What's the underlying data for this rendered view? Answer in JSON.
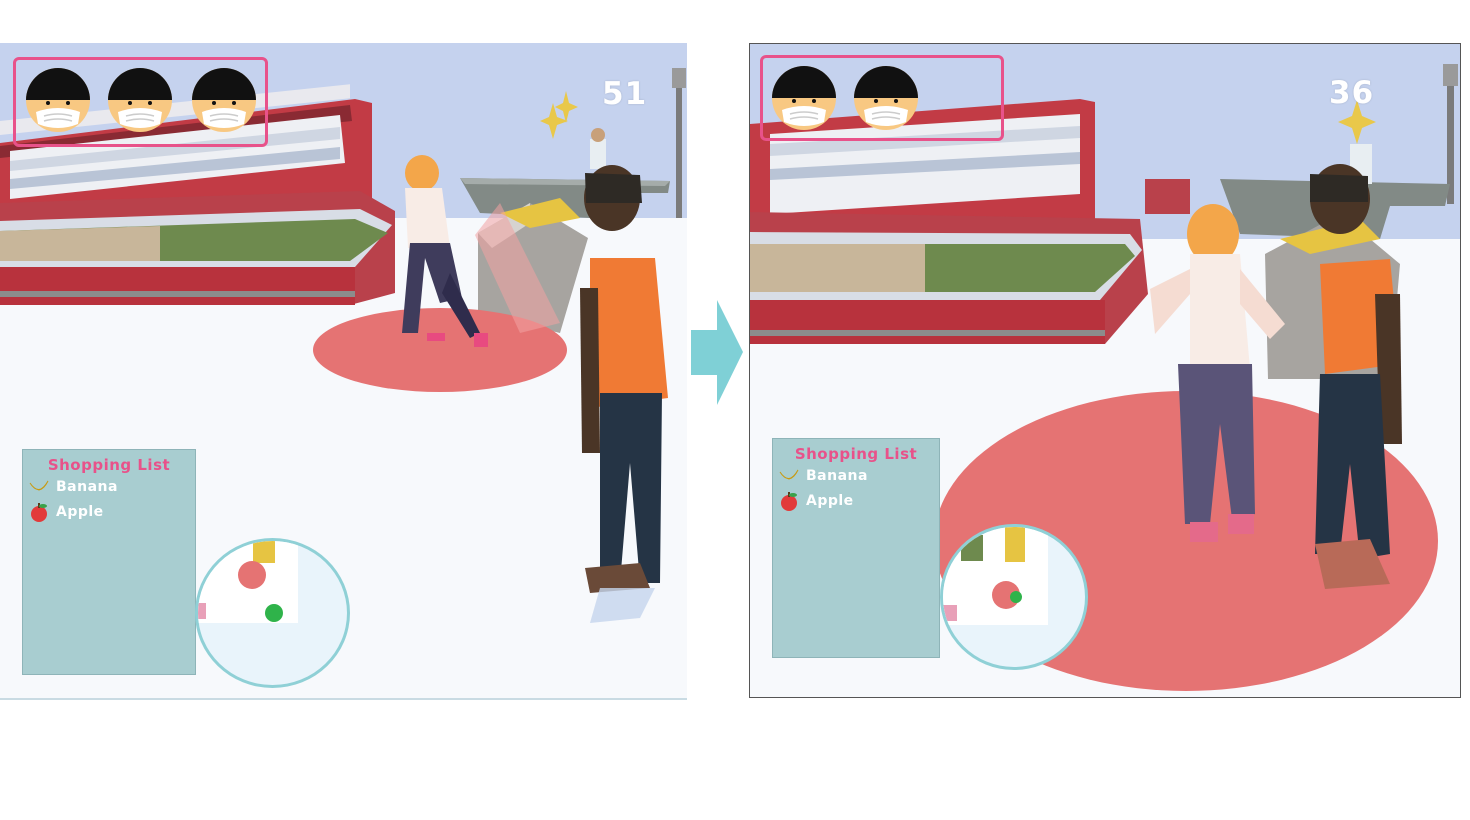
{
  "frames": [
    {
      "id": "before",
      "mask_faces": 3,
      "timer": "51",
      "shopping_list": {
        "title": "Shopping List",
        "items": [
          {
            "label": "Banana",
            "icon": "banana-icon"
          },
          {
            "label": "Apple",
            "icon": "apple-icon"
          }
        ]
      }
    },
    {
      "id": "after",
      "mask_faces": 2,
      "timer": "36",
      "shopping_list": {
        "title": "Shopping List",
        "items": [
          {
            "label": "Banana",
            "icon": "banana-icon"
          },
          {
            "label": "Apple",
            "icon": "apple-icon"
          }
        ]
      }
    }
  ],
  "colors": {
    "accent_pink": "#e8528a",
    "danger_zone": "#e57373",
    "shopping_panel": "#a8cdd0",
    "minimap_border": "#8fd0d6",
    "arrow": "#7fd0d6",
    "sky": "#c5d2ee"
  }
}
